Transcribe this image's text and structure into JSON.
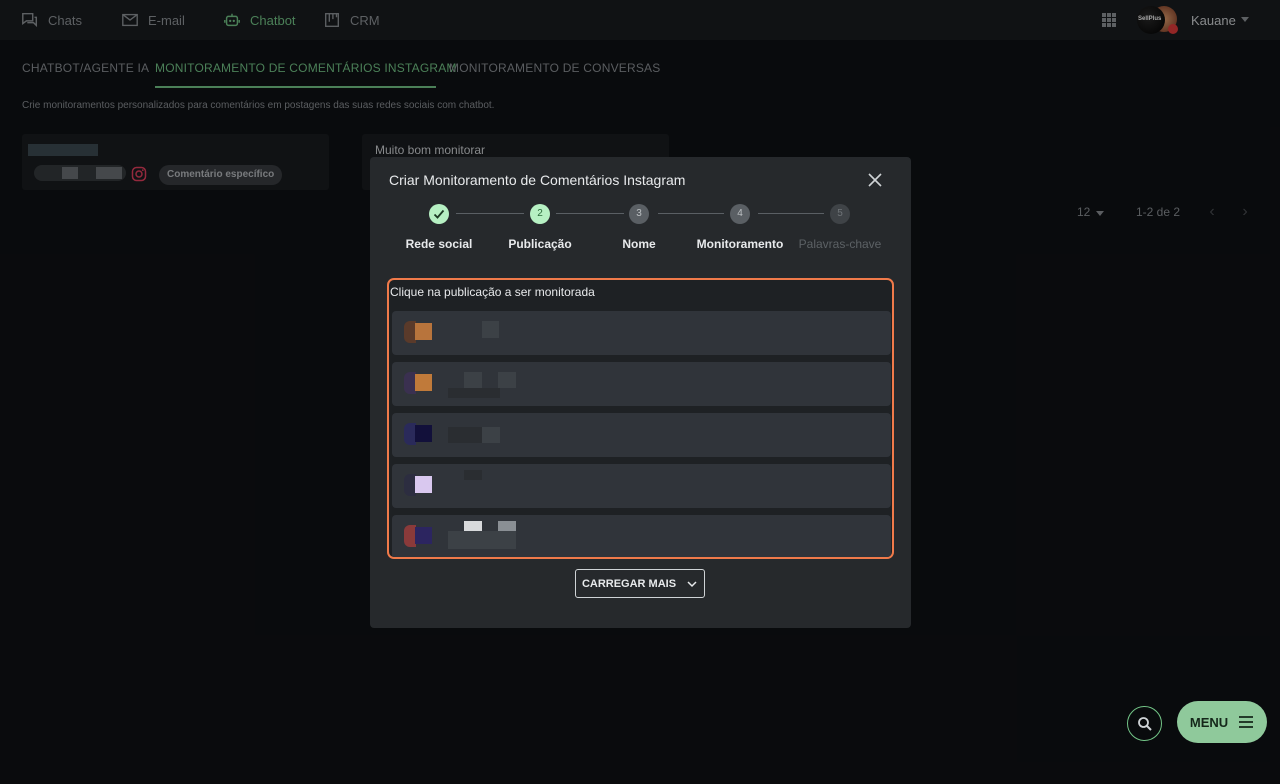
{
  "topbar": {
    "nav": [
      {
        "label": "Chats",
        "icon": "chats-icon"
      },
      {
        "label": "E-mail",
        "icon": "mail-icon"
      },
      {
        "label": "Chatbot",
        "icon": "robot-icon"
      },
      {
        "label": "CRM",
        "icon": "kanban-icon"
      }
    ],
    "active": "Chatbot",
    "user": {
      "name": "Kauane",
      "avatar_text": "SellPlus"
    }
  },
  "tabs": {
    "items": [
      "CHATBOT/AGENTE IA",
      "MONITORAMENTO DE COMENTÁRIOS INSTAGRAM",
      "MONITORAMENTO DE CONVERSAS"
    ],
    "active": "MONITORAMENTO DE COMENTÁRIOS INSTAGRAM"
  },
  "subtitle": "Crie monitoramentos personalizados para comentários em postagens das suas redes sociais com chatbot.",
  "cards": {
    "card1": {
      "chip": "Comentário específico"
    },
    "card2": {
      "title": "Muito bom monitorar"
    }
  },
  "pagination": {
    "per_page": "12",
    "range": "1-2 de 2"
  },
  "modal": {
    "title": "Criar Monitoramento de Comentários Instagram",
    "steps": [
      {
        "number": "1",
        "label": "Rede social",
        "state": "done"
      },
      {
        "number": "2",
        "label": "Publicação",
        "state": "current"
      },
      {
        "number": "3",
        "label": "Nome",
        "state": "todo"
      },
      {
        "number": "4",
        "label": "Monitoramento",
        "state": "todo"
      },
      {
        "number": "5",
        "label": "Palavras-chave",
        "state": "disabled"
      }
    ],
    "posts_hint": "Clique na publicação a ser monitorada",
    "load_more": "CARREGAR MAIS"
  },
  "fab": {
    "menu": "MENU"
  },
  "colors": {
    "accent": "#73c587",
    "highlight": "#f07a4a",
    "modal_bg": "#26292c"
  }
}
